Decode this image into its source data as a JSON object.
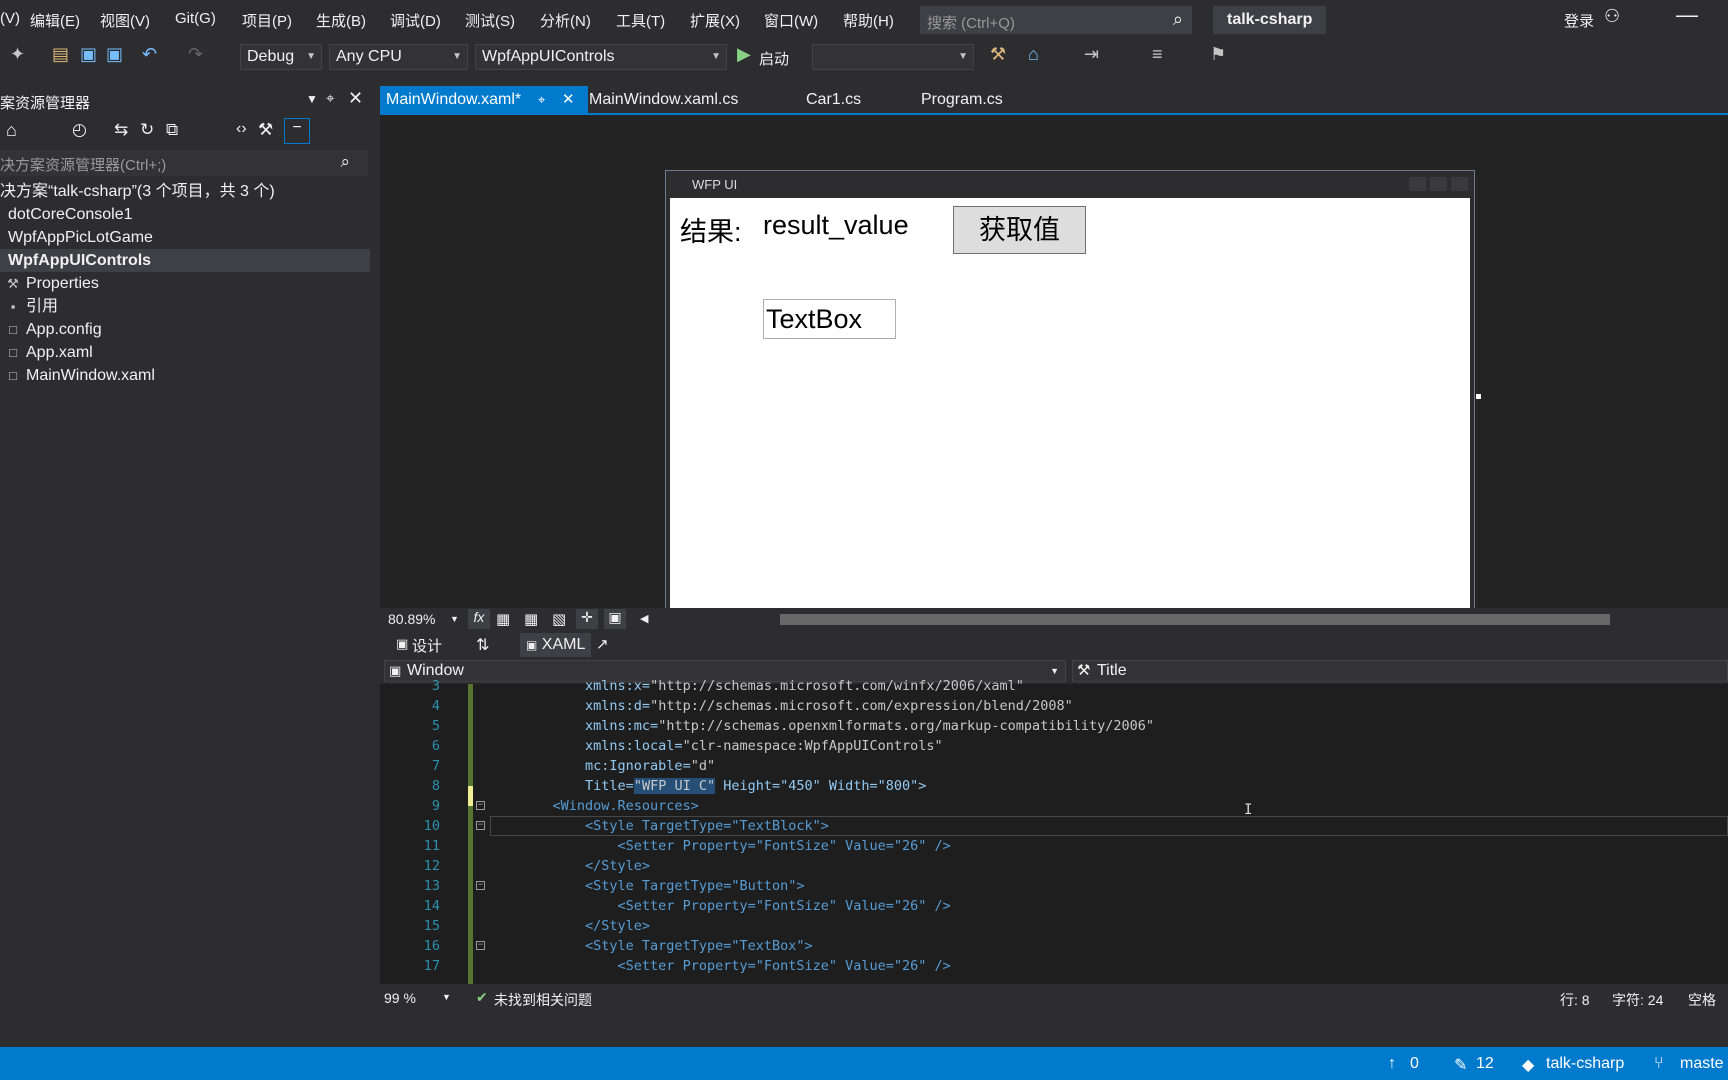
{
  "menu": {
    "items": [
      "(V)",
      "编辑(E)",
      "视图(V)",
      "Git(G)",
      "项目(P)",
      "生成(B)",
      "调试(D)",
      "测试(S)",
      "分析(N)",
      "工具(T)",
      "扩展(X)",
      "窗口(W)",
      "帮助(H)"
    ],
    "search_placeholder": "搜索 (Ctrl+Q)",
    "solution_name": "talk-csharp",
    "login": "登录"
  },
  "toolbar": {
    "config": "Debug",
    "platform": "Any CPU",
    "startup_project": "WpfAppUIControls",
    "start_label": "启动"
  },
  "solution_explorer": {
    "title": "案资源管理器",
    "search_placeholder": "决方案资源管理器(Ctrl+;)",
    "items": [
      {
        "label": "决方案“talk-csharp”(3 个项目，共 3 个)"
      },
      {
        "label": "dotCoreConsole1"
      },
      {
        "label": "WpfAppPicLotGame"
      },
      {
        "label": "WpfAppUIControls"
      },
      {
        "label": "Properties"
      },
      {
        "label": "引用"
      },
      {
        "label": "App.config"
      },
      {
        "label": "App.xaml"
      },
      {
        "label": "MainWindow.xaml"
      }
    ]
  },
  "tabs": [
    {
      "label": "MainWindow.xaml*"
    },
    {
      "label": "MainWindow.xaml.cs"
    },
    {
      "label": "Car1.cs"
    },
    {
      "label": "Program.cs"
    }
  ],
  "designer": {
    "window_title": "WFP UI",
    "result_label": "结果:",
    "result_value": "result_value",
    "button_label": "获取值",
    "textbox_text": "TextBox",
    "zoom": "80.89%",
    "design_tab": "设计",
    "xaml_tab": "XAML"
  },
  "nav": {
    "element": "Window",
    "property": "Title"
  },
  "code_lines": [
    {
      "n": "3",
      "indent": "        ",
      "a": "xmlns:x=",
      "s": "\"http://schemas.microsoft.com/winfx/2006/xaml\"",
      "tail": ""
    },
    {
      "n": "4",
      "indent": "        ",
      "a": "xmlns:d=",
      "s": "\"http://schemas.microsoft.com/expression/blend/2008\"",
      "tail": ""
    },
    {
      "n": "5",
      "indent": "        ",
      "a": "xmlns:mc=",
      "s": "\"http://schemas.openxmlformats.org/markup-compatibility/2006\"",
      "tail": ""
    },
    {
      "n": "6",
      "indent": "        ",
      "a": "xmlns:local=",
      "s": "\"clr-namespace:WpfAppUIControls\"",
      "tail": ""
    },
    {
      "n": "7",
      "indent": "        ",
      "a": "mc:Ignorable=",
      "s": "\"d\"",
      "tail": ""
    },
    {
      "n": "8",
      "indent": "        ",
      "a": "Title=",
      "s": "\"WFP UI C\"",
      "tail": " Height=\"450\" Width=\"800\">"
    },
    {
      "n": "9",
      "indent": "    ",
      "a": "",
      "s": "",
      "tail": "<Window.Resources>"
    },
    {
      "n": "10",
      "indent": "        ",
      "a": "",
      "s": "",
      "tail": "<Style TargetType=\"TextBlock\">"
    },
    {
      "n": "11",
      "indent": "            ",
      "a": "",
      "s": "",
      "tail": "<Setter Property=\"FontSize\" Value=\"26\" />"
    },
    {
      "n": "12",
      "indent": "        ",
      "a": "",
      "s": "",
      "tail": "</Style>"
    },
    {
      "n": "13",
      "indent": "        ",
      "a": "",
      "s": "",
      "tail": "<Style TargetType=\"Button\">"
    },
    {
      "n": "14",
      "indent": "            ",
      "a": "",
      "s": "",
      "tail": "<Setter Property=\"FontSize\" Value=\"26\" />"
    },
    {
      "n": "15",
      "indent": "        ",
      "a": "",
      "s": "",
      "tail": "</Style>"
    },
    {
      "n": "16",
      "indent": "        ",
      "a": "",
      "s": "",
      "tail": "<Style TargetType=\"TextBox\">"
    },
    {
      "n": "17",
      "indent": "            ",
      "a": "",
      "s": "",
      "tail": "<Setter Property=\"FontSize\" Value=\"26\" />"
    }
  ],
  "editor_status": {
    "zoom": "99 %",
    "issues": "未找到相关问题",
    "line": "行: 8",
    "col": "字符: 24",
    "spaces": "空格"
  },
  "statusbar": {
    "up_count": "0",
    "edit_count": "12",
    "repo": "talk-csharp",
    "branch": "maste"
  },
  "colors": {
    "accent": "#007acc",
    "background": "#2d2d30",
    "editor_bg": "#1e1e1e"
  }
}
